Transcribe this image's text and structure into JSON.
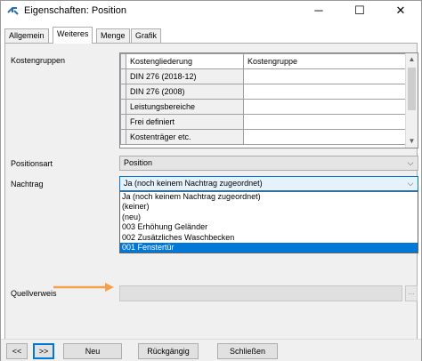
{
  "window": {
    "title": "Eigenschaften: Position",
    "minimize_glyph": "─",
    "maximize_glyph": "☐",
    "close_glyph": "✕"
  },
  "tabs": [
    {
      "label": "Allgemein"
    },
    {
      "label": "Weiteres"
    },
    {
      "label": "Menge"
    },
    {
      "label": "Grafik"
    }
  ],
  "active_tab": "Weiteres",
  "kostengruppen": {
    "label": "Kostengruppen",
    "columns": [
      "Kostengliederung",
      "Kostengruppe"
    ],
    "rows": [
      [
        "DIN 276 (2018-12)",
        ""
      ],
      [
        "DIN 276 (2008)",
        ""
      ],
      [
        "Leistungsbereiche",
        ""
      ],
      [
        "Frei definiert",
        ""
      ],
      [
        "Kostenträger etc.",
        ""
      ]
    ]
  },
  "positionsart": {
    "label": "Positionsart",
    "value": "Position"
  },
  "nachtrag": {
    "label": "Nachtrag",
    "value": "Ja (noch keinem Nachtrag zugeordnet)",
    "options": [
      "Ja (noch keinem Nachtrag zugeordnet)",
      "(keiner)",
      "(neu)",
      "003 Erhöhung Geländer",
      "002 Zusätzliches Waschbecken",
      "001 Fenstertür"
    ],
    "highlighted_option": "001 Fenstertür"
  },
  "quellverweis": {
    "label": "Quellverweis",
    "value": "",
    "button_label": "..."
  },
  "footer": {
    "prev_label": "<<",
    "next_label": ">>",
    "new_label": "Neu",
    "undo_label": "Rückgängig",
    "close_label": "Schließen"
  },
  "colors": {
    "selection": "#0078d7",
    "annotation_arrow": "#f5a04a"
  }
}
